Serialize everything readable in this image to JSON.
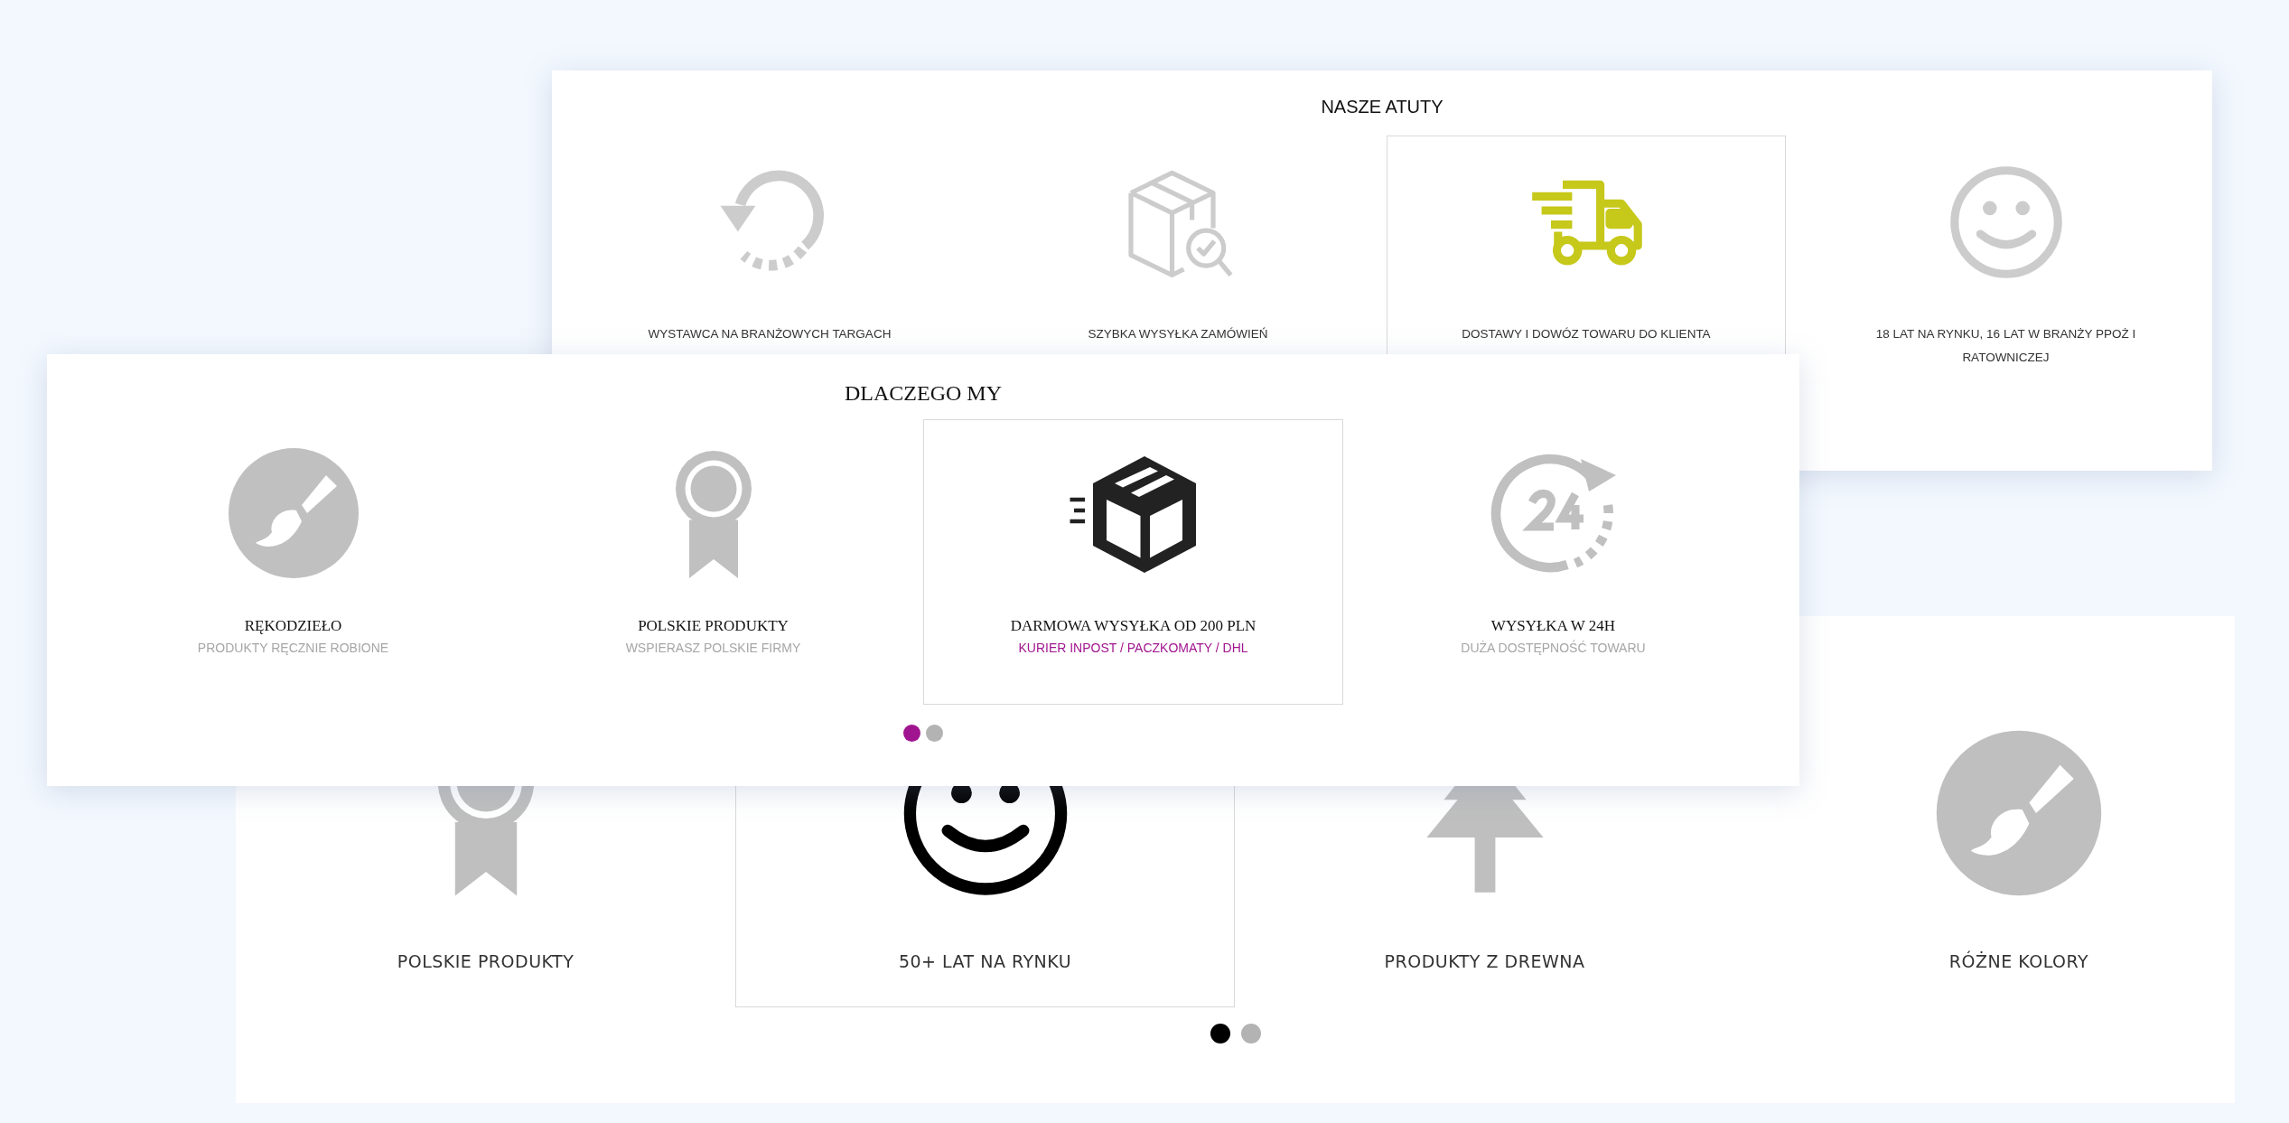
{
  "panel_nasze_atuty": {
    "title": "NASZE ATUTY",
    "items": [
      {
        "label": "WYSTAWCA NA BRANŻOWYCH TARGACH",
        "selected": false
      },
      {
        "label": "SZYBKA WYSYŁKA ZAMÓWIEŃ",
        "selected": false
      },
      {
        "label": "DOSTAWY I DOWÓZ TOWARU DO KLIENTA",
        "selected": true
      },
      {
        "label": "18 LAT NA RYNKU, 16 LAT W BRANŻY PPOŻ I RATOWNICZEJ",
        "selected": false
      }
    ]
  },
  "panel_dlaczego_my": {
    "title": "DLACZEGO MY",
    "items": [
      {
        "label": "RĘKODZIEŁO",
        "sublabel": "PRODUKTY RĘCZNIE ROBIONE",
        "selected": false
      },
      {
        "label": "POLSKIE PRODUKTY",
        "sublabel": "WSPIERASZ POLSKIE FIRMY",
        "selected": false
      },
      {
        "label": "DARMOWA WYSYŁKA OD 200 PLN",
        "sublabel": "KURIER INPOST / PACZKOMATY / DHL",
        "selected": true
      },
      {
        "label": "WYSYŁKA W 24H",
        "sublabel": "DUŻA DOSTĘPNOŚĆ TOWARU",
        "selected": false
      }
    ],
    "dots": [
      {
        "selected": true
      },
      {
        "selected": false
      }
    ]
  },
  "panel_third": {
    "items": [
      {
        "label": "POLSKIE PRODUKTY",
        "selected": false
      },
      {
        "label": "50+ LAT NA RYNKU",
        "selected": true
      },
      {
        "label": "PRODUKTY Z DREWNA",
        "selected": false
      },
      {
        "label": "RÓŻNE KOLORY",
        "selected": false
      }
    ],
    "dots": [
      {
        "selected": true
      },
      {
        "selected": false
      }
    ]
  }
}
